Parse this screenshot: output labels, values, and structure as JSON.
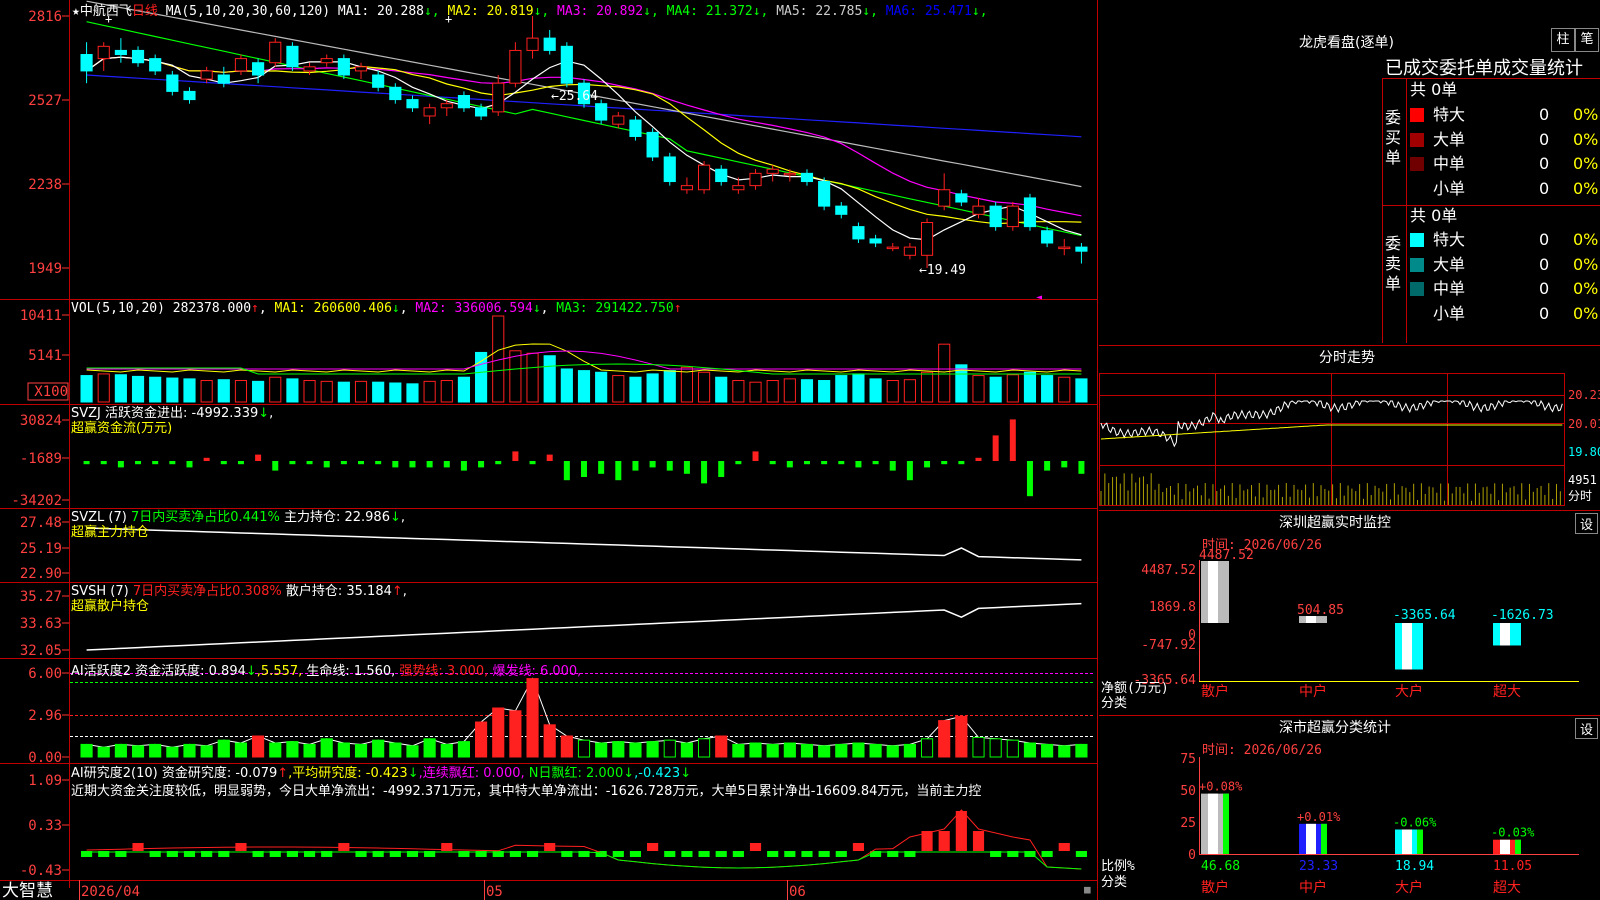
{
  "header": {
    "star": "★",
    "stock_name": "中航西飞",
    "period": "日线",
    "ma_spec": "MA(5,10,20,30,60,120)",
    "ma": [
      {
        "label": "MA1: 20.288",
        "arrow": "↓",
        "color": "#ffffff"
      },
      {
        "label": "MA2: 20.819",
        "arrow": "↓",
        "color": "#ffff00"
      },
      {
        "label": "MA3: 20.892",
        "arrow": "↓",
        "color": "#ff00ff"
      },
      {
        "label": "MA4: 21.372",
        "arrow": "↓",
        "color": "#00ff00"
      },
      {
        "label": "MA5: 22.785",
        "arrow": "↓",
        "color": "#cccccc"
      },
      {
        "label": "MA6: 25.471",
        "arrow": "↓",
        "color": "#0000ff"
      }
    ]
  },
  "colors": {
    "up": "#ff2020",
    "down": "#00ffff",
    "grid": "#c00000",
    "axis": "#ff4040",
    "green": "#00ff00",
    "yellow": "#ffff00",
    "magenta": "#ff00ff"
  },
  "price_axis": [
    "2816",
    "2527",
    "2238",
    "1949"
  ],
  "vol_axis": [
    "10411",
    "5141",
    "X100"
  ],
  "svzj_axis": [
    "30824",
    "-1689",
    "-34202"
  ],
  "svzl_axis": [
    "27.48",
    "25.19",
    "22.90"
  ],
  "svsh_axis": [
    "35.27",
    "33.63",
    "32.05"
  ],
  "ai1_axis": [
    "6.00",
    "2.96",
    "0.00"
  ],
  "ai2_axis": [
    "1.09",
    "0.33",
    "-0.43"
  ],
  "date_axis": {
    "d1": "2026/04",
    "d2": "05",
    "d3": "06"
  },
  "brand": "大智慧",
  "vol_header": {
    "spec": "VOL(5,10,20)",
    "val": "282378.000",
    "up": "↑",
    "ma1": "MA1: 260600.406",
    "ma1_arrow": "↓",
    "ma2": "MA2: 336006.594",
    "ma2_arrow": "↓",
    "ma3": "MA3: 291422.750",
    "ma3_arrow": "↑"
  },
  "svzj_header": {
    "l1": "SVZJ  活跃资金进出: -4992.339",
    "l1_arrow": "↓",
    "l1_end": ",",
    "l2": "超赢资金流(万元)"
  },
  "svzl_header": {
    "spec": "SVZL (7)",
    "g": "7日内买卖净占比0.441%",
    "w": "主力持仓: 22.986",
    "arrow": "↓",
    "end": ",",
    "l2": "超赢主力持仓"
  },
  "svsh_header": {
    "spec": "SVSH (7)",
    "r": "7日内买卖净占比0.308%",
    "w": "散户持仓: 35.184",
    "arrow": "↑",
    "end": ",",
    "l2": "超赢散户持仓"
  },
  "ai1_header": {
    "spec": "AI活跃度2",
    "a": "资金活跃度: 0.894",
    "a_arrow": "↓",
    "b": ",5.557,",
    "c": "生命线: 1.560,",
    "d": "强势线: 3.000,",
    "e": "爆发线: 6.000,"
  },
  "ai2_header": {
    "spec": "AI研究度2(10)",
    "a": "资金研究度: -0.079",
    "a_arrow": "↑",
    "b": ",平均研究度: -0.423",
    "b_arrow": "↓",
    "c": ",连续飘红: 0.000,",
    "d": "N日飘红: 2.000",
    "d_arrow": "↓",
    "e": ",-0.423",
    "e_arrow": "↓",
    "note": "近期大资金关注度较低，明显弱势，今日大单净流出：-4992.371万元，其中特大单净流出：-1626.728万元，大单5日累计净出-16609.84万元，当前主力控"
  },
  "annotations": {
    "high": "←25.64",
    "low": "←19.49"
  },
  "longhu": {
    "title": "龙虎看盘(逐单)",
    "btn1": "柱",
    "btn2": "笔",
    "tabs": "已成交委托单成交量统计",
    "buy_label": "委买单",
    "sell_label": "委卖单",
    "buy_total": "共 0单",
    "sell_total": "共 0单",
    "buy_rows": [
      {
        "name": "特大",
        "v": "0",
        "p": "0%",
        "c": "#ff0000"
      },
      {
        "name": "大单",
        "v": "0",
        "p": "0%",
        "c": "#a00000"
      },
      {
        "name": "中单",
        "v": "0",
        "p": "0%",
        "c": "#700000"
      },
      {
        "name": "小单",
        "v": "0",
        "p": "0%",
        "c": "#000000"
      }
    ],
    "sell_rows": [
      {
        "name": "特大",
        "v": "0",
        "p": "0%",
        "c": "#00ffff"
      },
      {
        "name": "大单",
        "v": "0",
        "p": "0%",
        "c": "#008a8a"
      },
      {
        "name": "中单",
        "v": "0",
        "p": "0%",
        "c": "#006a6a"
      },
      {
        "name": "小单",
        "v": "0",
        "p": "0%",
        "c": "#000000"
      }
    ]
  },
  "fenshi": {
    "title": "分时走势",
    "p1": "20.23",
    "p2": "20.01",
    "p3": "19.80",
    "vol": "4951",
    "unit": "分时"
  },
  "monitor": {
    "title": "深圳超赢实时监控",
    "btn": "设",
    "time": "时间: 2026/06/26",
    "axis": [
      "4487.52",
      "1869.8",
      "0",
      "-747.92",
      "-3365.64"
    ],
    "ylabel": "净额(万元)",
    "xlabel": "分类",
    "cats": [
      "散户",
      "中户",
      "大户",
      "超大"
    ],
    "values": [
      4487.52,
      504.85,
      -3365.64,
      -1626.73
    ],
    "labels": [
      "4487.52",
      "504.85",
      "-3365.64",
      "-1626.73"
    ]
  },
  "classify": {
    "title": "深市超赢分类统计",
    "btn": "设",
    "time": "时间: 2026/06/26",
    "axis": [
      "75",
      "50",
      "25",
      "0"
    ],
    "ylabel": "比例%",
    "xlabel": "分类",
    "cats": [
      "散户",
      "中户",
      "大户",
      "超大"
    ],
    "values": [
      46.68,
      23.33,
      18.94,
      11.05
    ],
    "labels": [
      "46.68",
      "23.33",
      "18.94",
      "11.05"
    ],
    "changes": [
      "+0.08%",
      "+0.01%",
      "-0.06%",
      "-0.03%"
    ]
  },
  "chart_data": {
    "type": "bar",
    "title": "深圳超赢实时监控",
    "categories": [
      "散户",
      "中户",
      "大户",
      "超大"
    ],
    "series": [
      {
        "name": "净额(万元)",
        "values": [
          4487.52,
          504.85,
          -3365.64,
          -1626.73
        ]
      },
      {
        "name": "比例%",
        "values": [
          46.68,
          23.33,
          18.94,
          11.05
        ]
      }
    ],
    "price_range": [
      19.49,
      25.64
    ],
    "candles": [
      {
        "o": 24.7,
        "c": 24.3,
        "h": 25.0,
        "l": 24.0
      },
      {
        "o": 24.6,
        "c": 24.9,
        "h": 25.0,
        "l": 24.3
      },
      {
        "o": 24.8,
        "c": 24.7,
        "h": 25.1,
        "l": 24.5
      },
      {
        "o": 24.8,
        "c": 24.5,
        "h": 24.9,
        "l": 24.4
      },
      {
        "o": 24.6,
        "c": 24.3,
        "h": 24.7,
        "l": 24.2
      },
      {
        "o": 24.2,
        "c": 23.8,
        "h": 24.3,
        "l": 23.7
      },
      {
        "o": 23.8,
        "c": 23.6,
        "h": 23.9,
        "l": 23.5
      },
      {
        "o": 24.1,
        "c": 24.3,
        "h": 24.4,
        "l": 24.0
      },
      {
        "o": 24.2,
        "c": 24.0,
        "h": 24.4,
        "l": 23.9
      },
      {
        "o": 24.3,
        "c": 24.6,
        "h": 24.7,
        "l": 24.2
      },
      {
        "o": 24.5,
        "c": 24.2,
        "h": 24.6,
        "l": 24.0
      },
      {
        "o": 24.5,
        "c": 25.0,
        "h": 25.1,
        "l": 24.4
      },
      {
        "o": 24.9,
        "c": 24.4,
        "h": 25.0,
        "l": 24.3
      },
      {
        "o": 24.3,
        "c": 24.4,
        "h": 24.5,
        "l": 24.2
      },
      {
        "o": 24.5,
        "c": 24.6,
        "h": 24.7,
        "l": 24.4
      },
      {
        "o": 24.6,
        "c": 24.2,
        "h": 24.7,
        "l": 24.1
      },
      {
        "o": 24.3,
        "c": 24.4,
        "h": 24.5,
        "l": 24.1
      },
      {
        "o": 24.2,
        "c": 23.9,
        "h": 24.3,
        "l": 23.8
      },
      {
        "o": 23.9,
        "c": 23.6,
        "h": 24.0,
        "l": 23.5
      },
      {
        "o": 23.6,
        "c": 23.4,
        "h": 23.7,
        "l": 23.3
      },
      {
        "o": 23.2,
        "c": 23.4,
        "h": 23.5,
        "l": 23.0
      },
      {
        "o": 23.4,
        "c": 23.5,
        "h": 23.6,
        "l": 23.2
      },
      {
        "o": 23.7,
        "c": 23.4,
        "h": 23.8,
        "l": 23.3
      },
      {
        "o": 23.4,
        "c": 23.2,
        "h": 23.5,
        "l": 23.1
      },
      {
        "o": 23.3,
        "c": 24.0,
        "h": 24.2,
        "l": 23.2
      },
      {
        "o": 24.0,
        "c": 24.8,
        "h": 25.0,
        "l": 23.9
      },
      {
        "o": 24.8,
        "c": 25.1,
        "h": 25.64,
        "l": 24.6
      },
      {
        "o": 25.1,
        "c": 24.8,
        "h": 25.3,
        "l": 24.7
      },
      {
        "o": 24.9,
        "c": 24.0,
        "h": 25.0,
        "l": 23.9
      },
      {
        "o": 24.0,
        "c": 23.5,
        "h": 24.1,
        "l": 23.4
      },
      {
        "o": 23.5,
        "c": 23.1,
        "h": 23.6,
        "l": 23.0
      },
      {
        "o": 23.0,
        "c": 23.2,
        "h": 23.3,
        "l": 22.9
      },
      {
        "o": 23.1,
        "c": 22.7,
        "h": 23.2,
        "l": 22.6
      },
      {
        "o": 22.8,
        "c": 22.2,
        "h": 22.9,
        "l": 22.1
      },
      {
        "o": 22.2,
        "c": 21.6,
        "h": 22.3,
        "l": 21.5
      },
      {
        "o": 21.4,
        "c": 21.5,
        "h": 21.7,
        "l": 21.3
      },
      {
        "o": 21.4,
        "c": 22.0,
        "h": 22.1,
        "l": 21.3
      },
      {
        "o": 21.9,
        "c": 21.6,
        "h": 22.0,
        "l": 21.5
      },
      {
        "o": 21.4,
        "c": 21.5,
        "h": 21.7,
        "l": 21.3
      },
      {
        "o": 21.5,
        "c": 21.8,
        "h": 21.9,
        "l": 21.4
      },
      {
        "o": 21.8,
        "c": 21.9,
        "h": 22.0,
        "l": 21.6
      },
      {
        "o": 21.8,
        "c": 21.8,
        "h": 21.9,
        "l": 21.6
      },
      {
        "o": 21.8,
        "c": 21.6,
        "h": 21.9,
        "l": 21.5
      },
      {
        "o": 21.6,
        "c": 21.0,
        "h": 21.7,
        "l": 20.9
      },
      {
        "o": 21.0,
        "c": 20.8,
        "h": 21.1,
        "l": 20.7
      },
      {
        "o": 20.5,
        "c": 20.2,
        "h": 20.6,
        "l": 20.1
      },
      {
        "o": 20.2,
        "c": 20.1,
        "h": 20.3,
        "l": 20.0
      },
      {
        "o": 20.0,
        "c": 20.0,
        "h": 20.1,
        "l": 19.9
      },
      {
        "o": 19.8,
        "c": 20.0,
        "h": 20.1,
        "l": 19.7
      },
      {
        "o": 19.8,
        "c": 20.6,
        "h": 20.7,
        "l": 19.49
      },
      {
        "o": 21.0,
        "c": 21.4,
        "h": 21.8,
        "l": 20.9
      },
      {
        "o": 21.3,
        "c": 21.1,
        "h": 21.4,
        "l": 21.0
      },
      {
        "o": 20.8,
        "c": 21.0,
        "h": 21.2,
        "l": 20.7
      },
      {
        "o": 21.0,
        "c": 20.5,
        "h": 21.1,
        "l": 20.4
      },
      {
        "o": 20.5,
        "c": 21.0,
        "h": 21.1,
        "l": 20.4
      },
      {
        "o": 21.2,
        "c": 20.5,
        "h": 21.3,
        "l": 20.4
      },
      {
        "o": 20.4,
        "c": 20.1,
        "h": 20.5,
        "l": 20.0
      },
      {
        "o": 20.0,
        "c": 20.0,
        "h": 20.2,
        "l": 19.8
      },
      {
        "o": 20.0,
        "c": 19.9,
        "h": 20.1,
        "l": 19.6
      }
    ],
    "volume_range": [
      0,
      10411
    ],
    "svzj_range": [
      -34202,
      30824
    ]
  }
}
